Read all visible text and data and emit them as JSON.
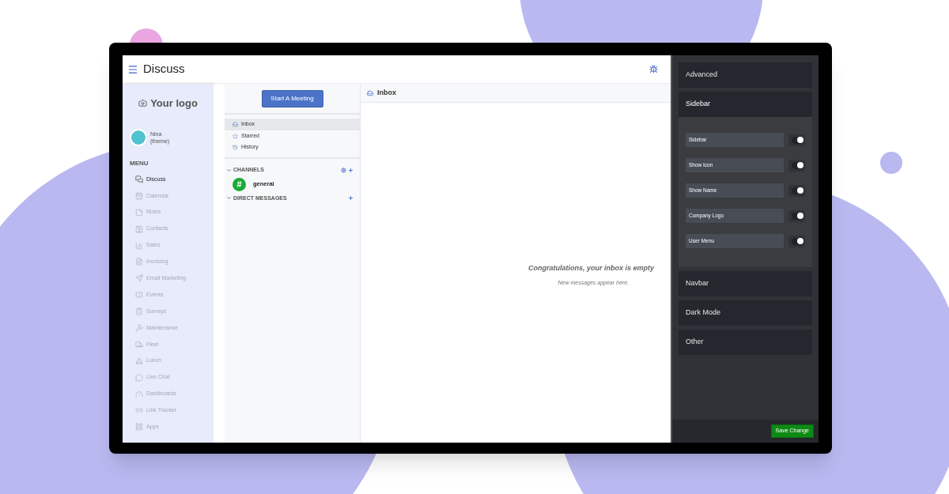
{
  "topbar": {
    "title": "Discuss"
  },
  "sidebar": {
    "logo": "Your logo",
    "user": {
      "name": "Nina",
      "subtitle": "(theme)"
    },
    "menu_title": "MENU",
    "items": [
      {
        "label": "Discuss",
        "selected": true
      },
      {
        "label": "Calendar",
        "selected": false
      },
      {
        "label": "Notes",
        "selected": false
      },
      {
        "label": "Contacts",
        "selected": false
      },
      {
        "label": "Sales",
        "selected": false
      },
      {
        "label": "Invoicing",
        "selected": false
      },
      {
        "label": "Email Marketing",
        "selected": false
      },
      {
        "label": "Events",
        "selected": false
      },
      {
        "label": "Surveys",
        "selected": false
      },
      {
        "label": "Maintenance",
        "selected": false
      },
      {
        "label": "Fleet",
        "selected": false
      },
      {
        "label": "Lunch",
        "selected": false
      },
      {
        "label": "Live Chat",
        "selected": false
      },
      {
        "label": "Dashboards",
        "selected": false
      },
      {
        "label": "Link Tracker",
        "selected": false
      },
      {
        "label": "Apps",
        "selected": false
      }
    ]
  },
  "discuss": {
    "meeting_button": "Start A Meeting",
    "mailboxes": [
      {
        "label": "Inbox",
        "selected": true
      },
      {
        "label": "Starred",
        "selected": false
      },
      {
        "label": "History",
        "selected": false
      }
    ],
    "channels": {
      "title": "CHANNELS",
      "items": [
        {
          "symbol": "#",
          "name": "general"
        }
      ]
    },
    "direct_messages": {
      "title": "DIRECT MESSAGES"
    }
  },
  "content": {
    "title": "Inbox",
    "empty_title": "Congratulations, your inbox is empty",
    "empty_text": "New messages appear here."
  },
  "settings": {
    "sections": [
      {
        "title": "Advanced",
        "expanded": false
      },
      {
        "title": "Sidebar",
        "expanded": true,
        "options": [
          {
            "label": "Sidebar",
            "on": true
          },
          {
            "label": "Show Icon",
            "on": true
          },
          {
            "label": "Show Name",
            "on": true
          },
          {
            "label": "Company Logo",
            "on": true
          },
          {
            "label": "User Menu",
            "on": true
          }
        ]
      },
      {
        "title": "Navbar",
        "expanded": false
      },
      {
        "title": "Dark Mode",
        "expanded": false
      },
      {
        "title": "Other",
        "expanded": false
      }
    ],
    "save_button": "Save Change"
  }
}
